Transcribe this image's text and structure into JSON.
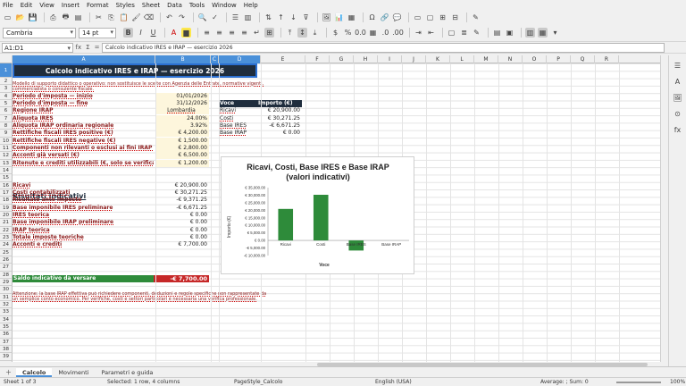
{
  "menu": [
    "File",
    "Edit",
    "View",
    "Insert",
    "Format",
    "Styles",
    "Sheet",
    "Data",
    "Tools",
    "Window",
    "Help"
  ],
  "font_name": "Cambria",
  "font_size": "14 pt",
  "cell_ref": "A1:D1",
  "formula": "Calcolo indicativo IRES e IRAP — esercizio 2026",
  "columns": [
    "A",
    "B",
    "C",
    "D",
    "E",
    "F",
    "G",
    "H",
    "I",
    "J",
    "K",
    "L",
    "M",
    "N",
    "O",
    "P",
    "Q",
    "R"
  ],
  "rows": [
    "1",
    "2",
    "3",
    "4",
    "5",
    "6",
    "7",
    "8",
    "9",
    "10",
    "11",
    "12",
    "13",
    "14",
    "15",
    "16",
    "17",
    "18",
    "19",
    "20",
    "21",
    "22",
    "23",
    "24",
    "25",
    "26",
    "27",
    "28",
    "29",
    "30",
    "31",
    "32",
    "33",
    "34",
    "35",
    "36",
    "37",
    "38",
    "39",
    "40"
  ],
  "sheet": {
    "title": "Calcolo indicativo IRES e IRAP — esercizio 2026",
    "subtitle": "Modello di supporto didattico o operativo: non sostituisce le scelte con Agenzia delle Entrate, normative vigenti, commercialista o consulente fiscale.",
    "inputs": [
      {
        "label": "Periodo d'imposta — inizio",
        "value": "01/01/2026"
      },
      {
        "label": "Periodo d'imposta — fine",
        "value": "31/12/2026"
      },
      {
        "label": "Regione IRAP",
        "value": "Lombardia"
      },
      {
        "label": "Aliquota IRES",
        "value": "24.00%"
      },
      {
        "label": "Aliquota IRAP ordinaria regionale",
        "value": "3.92%"
      },
      {
        "label": "Rettifiche fiscali IRES positive (€)",
        "value": "€ 4,200.00"
      },
      {
        "label": "Rettifiche fiscali IRES negative (€)",
        "value": "€ 1,500.00"
      },
      {
        "label": "Componenti non rilevanti o esclusi ai fini IRAP (€)",
        "value": "€ 2,800.00"
      },
      {
        "label": "Acconti già versati (€)",
        "value": "€ 6,500.00"
      },
      {
        "label": "Ritenute e crediti utilizzabili (€, solo se verificati)",
        "value": "€ 1,200.00"
      }
    ],
    "results_title": "Risultati indicativi",
    "results": [
      {
        "label": "Ricavi",
        "value": "€ 20,900.00"
      },
      {
        "label": "Costi contabilizzati",
        "value": "€ 30,271.25"
      },
      {
        "label": "Risultato ante imposte",
        "value": "-€ 9,371.25"
      },
      {
        "label": "Base imponibile IRES preliminare",
        "value": "-€ 6,671.25"
      },
      {
        "label": "IRES teorica",
        "value": "€ 0.00"
      },
      {
        "label": "Base imponibile IRAP preliminare",
        "value": "€ 0.00"
      },
      {
        "label": "IRAP teorica",
        "value": "€ 0.00"
      },
      {
        "label": "Totale imposte teoriche",
        "value": "€ 0.00"
      },
      {
        "label": "Acconti e crediti",
        "value": "€ 7,700.00"
      }
    ],
    "balance": {
      "label": "Saldo indicativo da versare",
      "value": "-€ 7,700.00"
    },
    "note": "Attenzione: la base IRAP effettiva può richiedere componenti, deduzioni e regole specifiche non rappresentate da un semplice conto economico. Per verifiche, costi e settori particolari è necessaria una verifica professionale.",
    "summary_headers": [
      "Voce",
      "Importo (€)"
    ],
    "summary": [
      {
        "label": "Ricavi",
        "value": "€ 20,900.00"
      },
      {
        "label": "Costi",
        "value": "€ 30,271.25"
      },
      {
        "label": "Base IRES",
        "value": "-€ 6,671.25"
      },
      {
        "label": "Base IRAP",
        "value": "€ 0.00"
      }
    ]
  },
  "chart_data": {
    "type": "bar",
    "title": "Ricavi, Costi, Base IRES e Base IRAP (valori indicativi)",
    "title_line1": "Ricavi, Costi, Base IRES e Base IRAP",
    "title_line2": "(valori indicativi)",
    "categories": [
      "Ricavi",
      "Costi",
      "Base IRES",
      "Base IRAP"
    ],
    "values": [
      20900,
      30271.25,
      -6671.25,
      0
    ],
    "xlabel": "Voce",
    "ylabel": "Importo (€)",
    "ylim": [
      -10000,
      35000
    ],
    "yticks": [
      "€ 35,000.00",
      "€ 30,000.00",
      "€ 25,000.00",
      "€ 20,000.00",
      "€ 15,000.00",
      "€ 10,000.00",
      "€ 5,000.00",
      "€ 0.00",
      "-€ 5,000.00",
      "-€ 10,000.00"
    ],
    "bar_color": "#2e8b3a",
    "grid": false
  },
  "tabs": [
    "Calcolo",
    "Movimenti",
    "Parametri e guida"
  ],
  "status": {
    "sheet": "Sheet 1 of 3",
    "selection": "Selected: 1 row, 4 columns",
    "style": "PageStyle_Calcolo",
    "lang": "English (USA)",
    "summary": "Average: ; Sum: 0",
    "zoom": "100%"
  },
  "colors": {
    "accent": "#4a90d9",
    "dark": "#1f2d3d",
    "green": "#2e8b3a",
    "red": "#c62828"
  }
}
